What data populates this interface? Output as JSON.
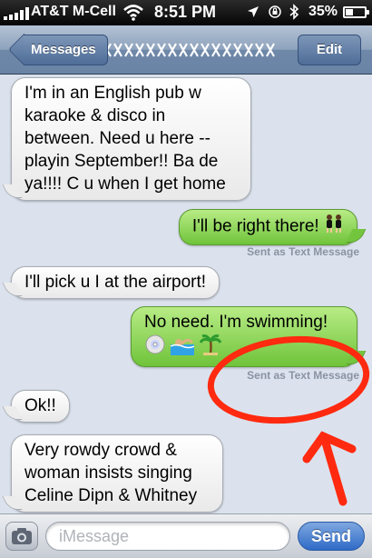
{
  "status_bar": {
    "carrier": "AT&T M-Cell",
    "time": "8:51 PM",
    "battery_text": "35%",
    "battery_level": 0.35,
    "icons": [
      "signal-icon",
      "wifi-icon",
      "location-icon",
      "rotation-lock-icon",
      "bluetooth-icon",
      "battery-icon"
    ]
  },
  "nav": {
    "back_label": "Messages",
    "title": "xxxxxxxxxxxx",
    "edit_label": "Edit"
  },
  "messages": [
    {
      "direction": "in",
      "text": "I'm in an English pub w karaoke & disco in between. Need u here -- playin September!! Ba de ya!!!! C u when I get home"
    },
    {
      "direction": "out",
      "text": "I'll be right there!",
      "emoji": [
        "dancers-emoji"
      ],
      "note": "Sent as Text Message"
    },
    {
      "direction": "in",
      "text": "I'll pick u I at the airport!"
    },
    {
      "direction": "out",
      "text": "No need. I'm swimming!",
      "emoji": [
        "cd-emoji",
        "swimmer-emoji",
        "palm-tree-emoji"
      ],
      "note": "Sent as Text Message"
    },
    {
      "direction": "in",
      "text": "Ok!!"
    },
    {
      "direction": "in",
      "text": "Very rowdy crowd & woman insists singing Celine Dipn & Whitney"
    }
  ],
  "annotation": {
    "color": "#ff2a0f",
    "shapes": [
      "circle",
      "arrow"
    ]
  },
  "input_bar": {
    "placeholder": "iMessage",
    "send_label": "Send"
  },
  "colors": {
    "incoming_bubble": "#f2f2f2",
    "outgoing_bubble": "#8fd85a",
    "nav_bar": "#8ea3bd",
    "send_button": "#3b78d1"
  }
}
